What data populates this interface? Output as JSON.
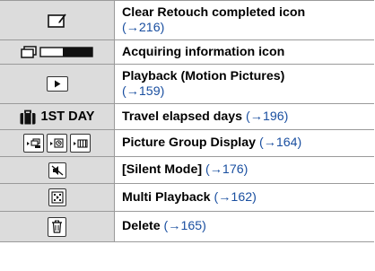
{
  "rows": [
    {
      "name": "Clear Retouch completed icon",
      "ref": "(→216)",
      "icon": "clear-retouch-icon"
    },
    {
      "name": "Acquiring information icon",
      "ref": "",
      "icon": "acquiring-info-icon"
    },
    {
      "name": "Playback (Motion Pictures)",
      "ref": "(→159)",
      "icon": "play-icon"
    },
    {
      "name": "Travel elapsed days",
      "ref": "(→196)",
      "icon": "suitcase-icon",
      "icon_text": "1ST DAY"
    },
    {
      "name": "Picture Group Display",
      "ref": "(→164)",
      "icon": "picture-group-icon"
    },
    {
      "name": "[Silent Mode]",
      "ref": "(→176)",
      "icon": "silent-mode-icon"
    },
    {
      "name": "Multi Playback",
      "ref": "(→162)",
      "icon": "multi-playback-icon"
    },
    {
      "name": "Delete",
      "ref": "(→165)",
      "icon": "trash-icon"
    }
  ]
}
